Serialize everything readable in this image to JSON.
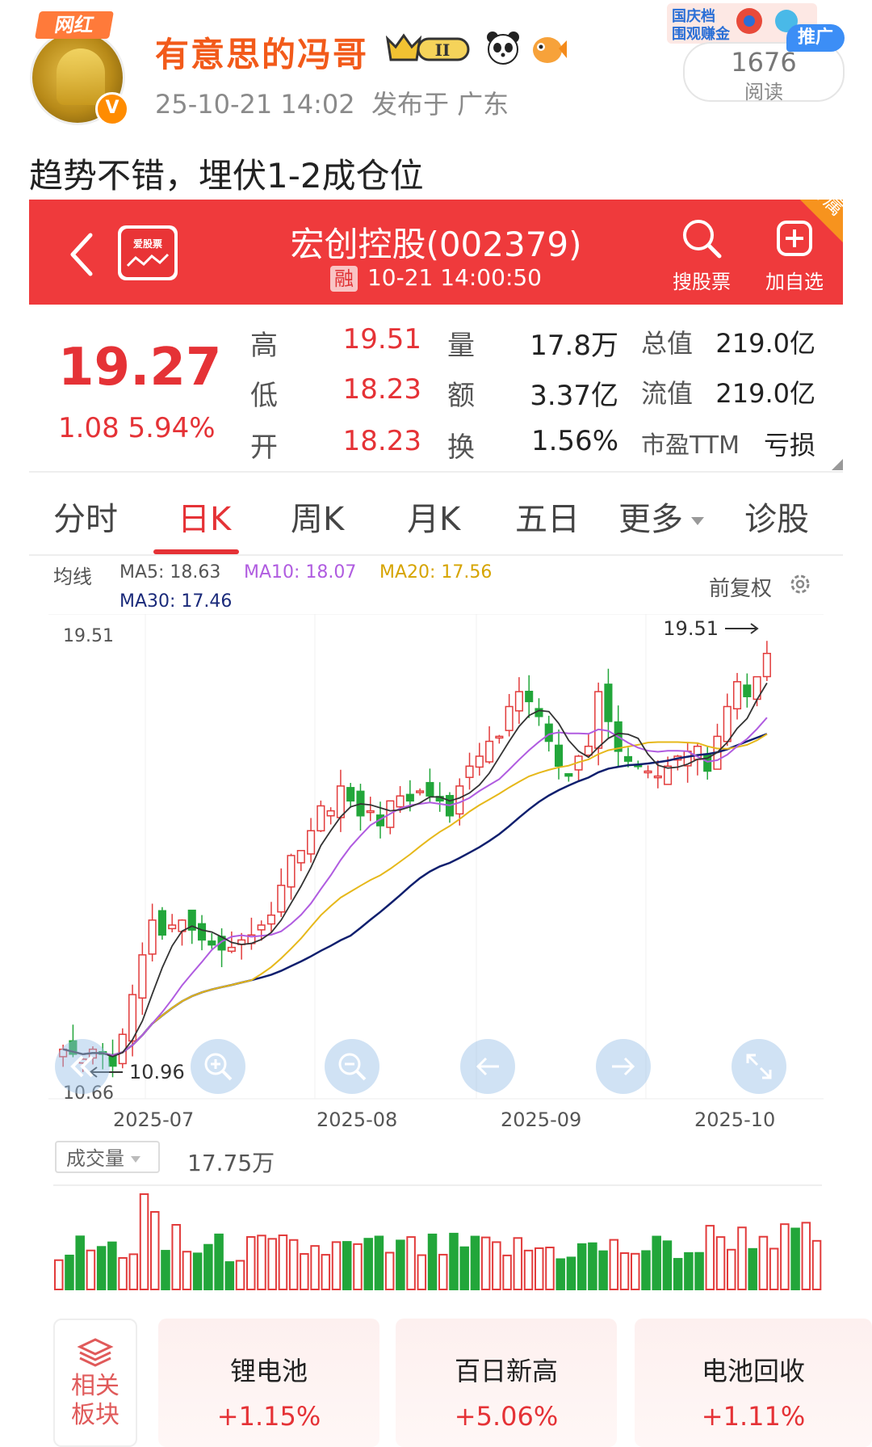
{
  "post": {
    "badge": "网红",
    "username": "有意思的冯哥",
    "vip_level": "II",
    "timestamp": "25-10-21 14:02",
    "location": "发布于 广东",
    "promo_label": "推广",
    "promo_banner": "国庆档 围观赚金",
    "read_count": "1676",
    "read_label": "阅读",
    "text": "趋势不错，埋伏1-2成仓位"
  },
  "stock_header": {
    "name": "宏创控股(002379)",
    "margin_tag": "融",
    "datetime": "10-21 14:00:50",
    "logo_label": "爱股票",
    "search_label": "搜股票",
    "add_label": "加自选",
    "exclusive_tag": "专属",
    "bg_color": "#ef3a3c"
  },
  "quote": {
    "price": "19.27",
    "change": "1.08 5.94%",
    "rows": [
      {
        "k1": "高",
        "v1": "19.51",
        "k2": "量",
        "v2": "17.8万",
        "k3": "总值",
        "v3": "219.0亿"
      },
      {
        "k1": "低",
        "v1": "18.23",
        "k2": "额",
        "v2": "3.37亿",
        "k3": "流值",
        "v3": "219.0亿"
      },
      {
        "k1": "开",
        "v1": "18.23",
        "k2": "换",
        "v2": "1.56%",
        "k3": "市盈TTM",
        "v3": "亏损"
      }
    ]
  },
  "tabs": [
    "分时",
    "日K",
    "周K",
    "月K",
    "五日",
    "更多",
    "诊股"
  ],
  "active_tab": "日K",
  "ma": {
    "label": "均线",
    "ma5": "MA5: 18.63",
    "ma10": "MA10: 18.07",
    "ma20": "MA20: 17.56",
    "ma30": "MA30: 17.46",
    "adjust": "前复权",
    "colors": {
      "ma5": "#333333",
      "ma10": "#b05ce0",
      "ma20": "#e6b81a",
      "ma30": "#0f1f6e"
    }
  },
  "kline": {
    "high_label": "19.51",
    "high_marker": "19.51",
    "low_label": "10.96",
    "low_axis": "10.66",
    "months": [
      "2025-07",
      "2025-08",
      "2025-09",
      "2025-10"
    ]
  },
  "volume": {
    "selector": "成交量",
    "value": "17.75万"
  },
  "related": {
    "label": "相关板块",
    "sectors": [
      {
        "name": "锂电池",
        "change": "+1.15%"
      },
      {
        "name": "百日新高",
        "change": "+5.06%"
      },
      {
        "name": "电池回收",
        "change": "+1.11%"
      }
    ]
  },
  "chart_data": {
    "type": "candlestick",
    "title": "",
    "ylim": [
      10.66,
      19.51
    ],
    "x_ticks": [
      "2025-07",
      "2025-08",
      "2025-09",
      "2025-10"
    ],
    "closes": [
      11.3,
      11.2,
      11.1,
      11.3,
      11.2,
      10.96,
      11.6,
      12.4,
      13.2,
      13.9,
      13.6,
      13.8,
      13.9,
      13.7,
      13.5,
      13.4,
      13.3,
      13.35,
      13.5,
      13.6,
      13.8,
      14.0,
      14.6,
      15.2,
      15.3,
      15.7,
      16.2,
      16.1,
      16.6,
      16.3,
      16.0,
      16.1,
      15.8,
      16.3,
      16.4,
      16.3,
      16.5,
      16.4,
      16.3,
      16.0,
      16.6,
      17.0,
      17.2,
      17.5,
      17.6,
      18.2,
      18.5,
      18.3,
      18.0,
      17.5,
      17.0,
      16.8,
      17.2,
      17.4,
      18.5,
      17.9,
      17.3,
      17.1,
      17.0,
      16.9,
      16.8,
      17.0,
      17.2,
      17.3,
      17.4,
      16.9,
      17.6,
      18.2,
      18.7,
      18.4,
      18.8,
      19.27
    ],
    "ma_current": {
      "MA5": 18.63,
      "MA10": 18.07,
      "MA20": 17.56,
      "MA30": 17.46
    },
    "volume_latest": "17.75万"
  }
}
